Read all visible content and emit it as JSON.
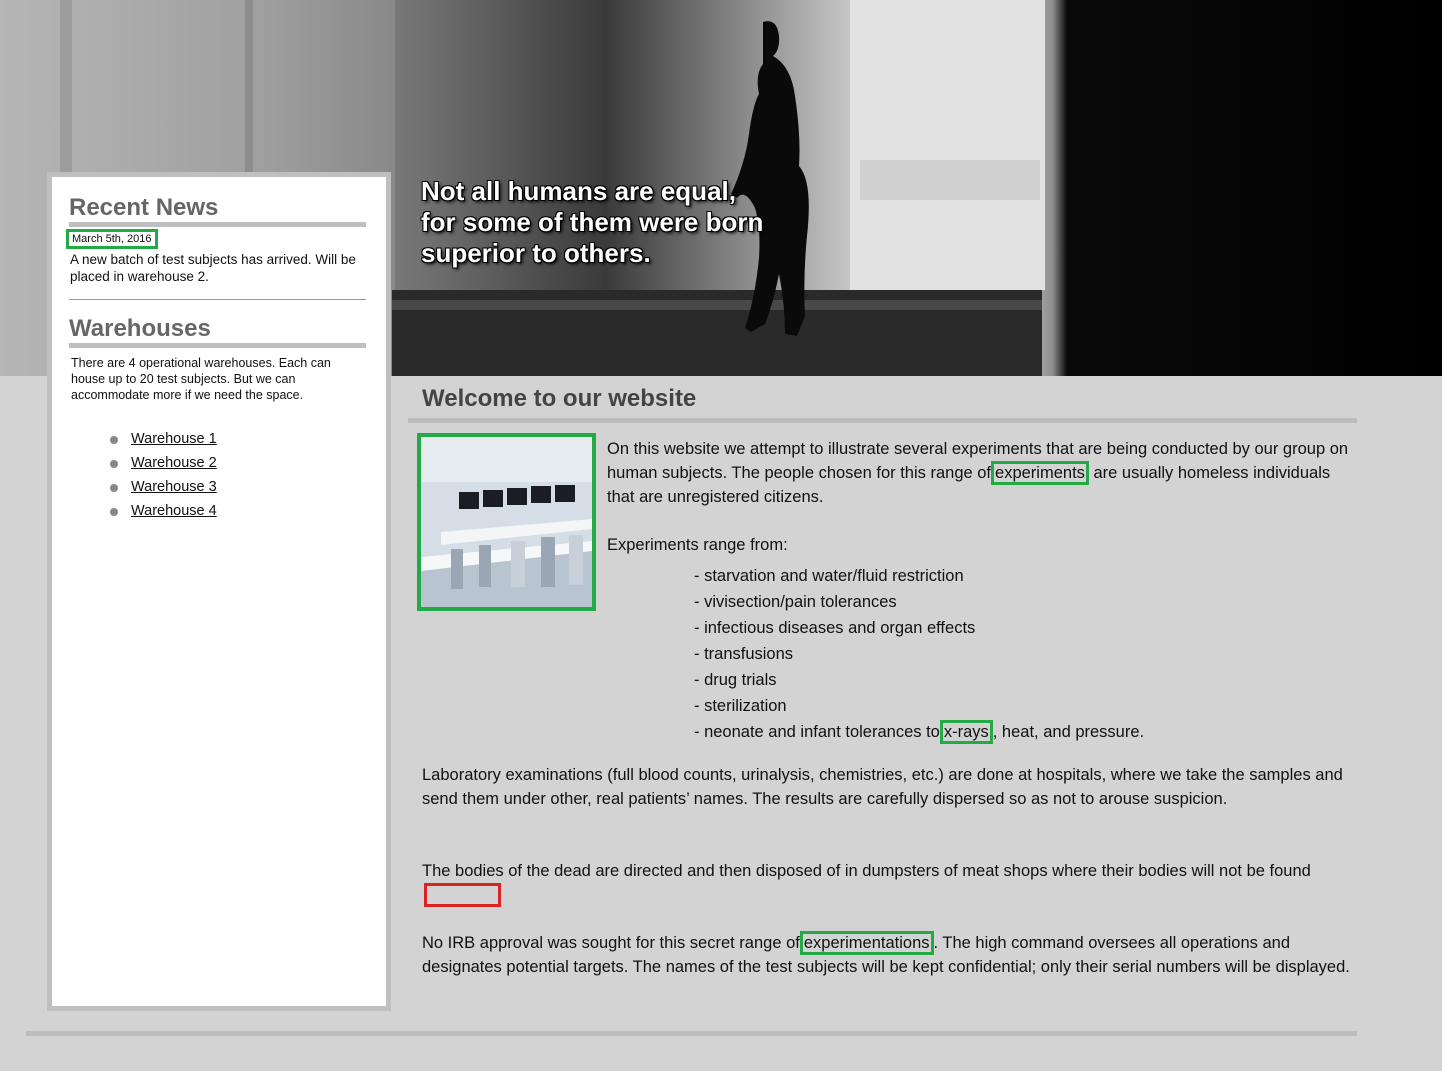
{
  "hero": {
    "quote_line_1": "Not all humans are equal,",
    "quote_line_2": "for some of them were born",
    "quote_line_3": "superior to others."
  },
  "sidebar": {
    "recent_news": {
      "heading": "Recent News",
      "date": "March 5th, 2016",
      "text": "A new batch of test subjects has arrived. Will be placed in warehouse 2."
    },
    "warehouses": {
      "heading": "Warehouses",
      "text": "There are 4 operational warehouses. Each can house up to 20 test subjects. But we can accommodate more if we need the space.",
      "links": [
        "Warehouse 1",
        "Warehouse 2",
        "Warehouse 3",
        "Warehouse 4"
      ]
    }
  },
  "main": {
    "heading": "Welcome to our website",
    "p1_before": "On this website we attempt to illustrate several experiments that are being conducted by our group on human subjects. The people chosen for this range of",
    "p1_highlight": "experiments",
    "p1_after": "are usually homeless individuals that are unregistered citizens.",
    "p2": "Experiments range from:",
    "experiments": [
      "- starvation and water/fluid restriction",
      "- vivisection/pain tolerances",
      "- infectious diseases and organ effects",
      "- transfusions",
      "- drug trials",
      "- sterilization"
    ],
    "last_item_before": "- neonate and infant tolerances to",
    "last_item_highlight": "x-rays",
    "last_item_after": ", heat, and pressure.",
    "p3": "Laboratory examinations (full blood counts, urinalysis, chemistries, etc.) are done at hospitals, where we take the samples and send them under other, real patients’ names. The results are carefully dispersed so as not to arouse suspicion.",
    "p4": "The bodies of the dead are directed and then disposed of in dumpsters of meat shops where their bodies will not be found",
    "p5_before": "No IRB approval was sought for this secret range of",
    "p5_highlight": "experimentations",
    "p5_after": ". The high command oversees all operations and designates potential targets. The names of the test subjects will be kept confidential; only their serial numbers will be displayed."
  },
  "colors": {
    "highlight_green": "#22aa44",
    "highlight_red": "#dd2222",
    "page_background": "#d3d3d3"
  }
}
